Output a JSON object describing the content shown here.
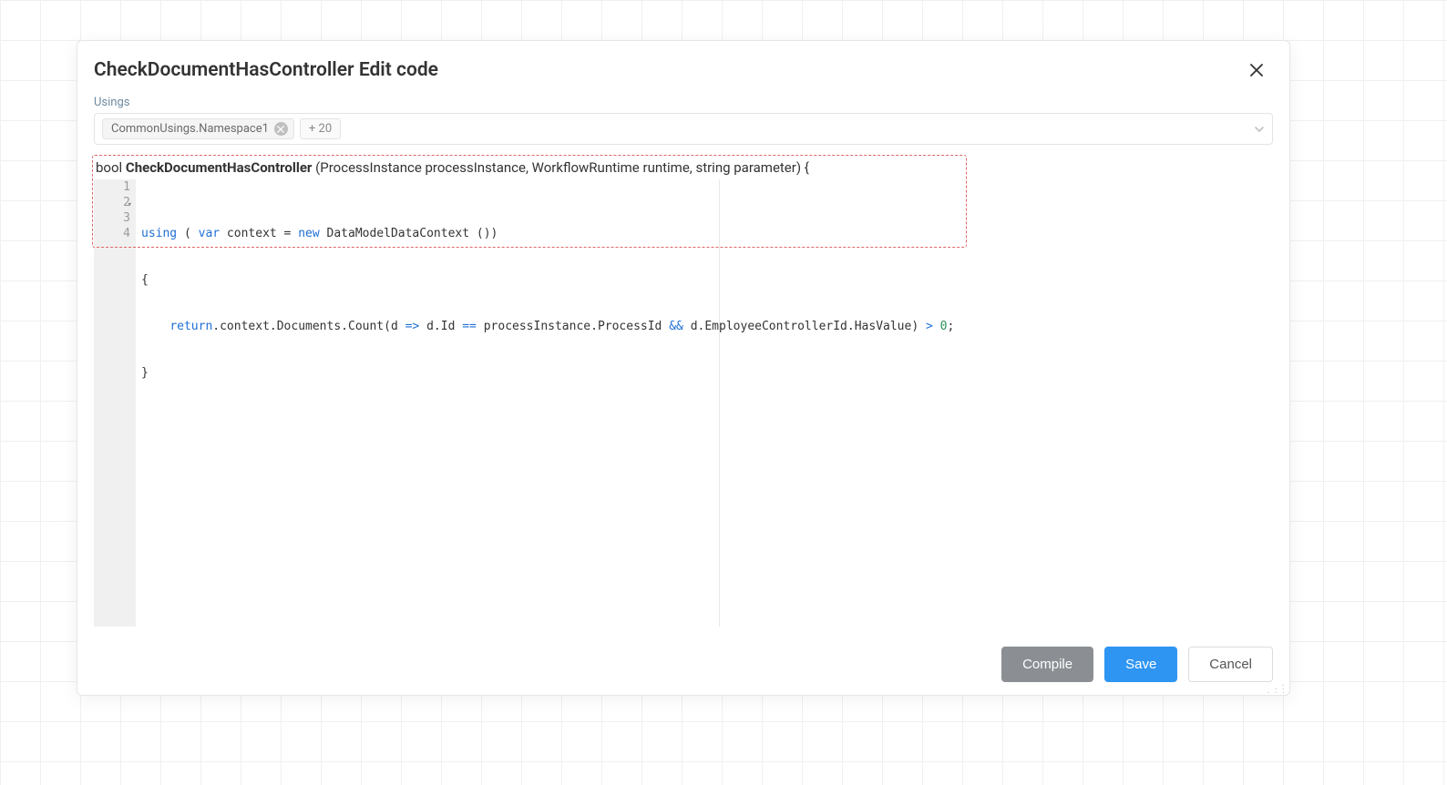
{
  "modal": {
    "title": "CheckDocumentHasController Edit code"
  },
  "usings": {
    "label": "Usings",
    "tag_label": "CommonUsings.Namespace1",
    "more_label": "+ 20"
  },
  "signature": {
    "ret": "bool ",
    "name": "CheckDocumentHasController",
    "params": " (ProcessInstance processInstance, WorkflowRuntime runtime, string parameter) {"
  },
  "code": {
    "line_numbers": [
      "1",
      "2",
      "3",
      "4"
    ],
    "line1_kw_using": "using",
    "line1_mid1": " ( ",
    "line1_kw_var": "var",
    "line1_mid2": " context = ",
    "line1_kw_new": "new",
    "line1_rest": " DataModelDataContext ())",
    "line2": "{",
    "line3_indent": "    ",
    "line3_kw_return": "return",
    "line3_a": ".context.Documents.Count(d ",
    "line3_op_arrow": "=>",
    "line3_b": " d.Id ",
    "line3_op_eq": "==",
    "line3_c": " processInstance.ProcessId ",
    "line3_op_and": "&&",
    "line3_d": " d.EmployeeControllerId.HasValue) ",
    "line3_op_gt": ">",
    "line3_sp": " ",
    "line3_zero": "0",
    "line3_semi": ";",
    "line4": "}"
  },
  "buttons": {
    "compile": "Compile",
    "save": "Save",
    "cancel": "Cancel"
  },
  "colors": {
    "accent": "#2e95f2",
    "highlight_border": "#e06666",
    "muted": "#8b8f94"
  }
}
